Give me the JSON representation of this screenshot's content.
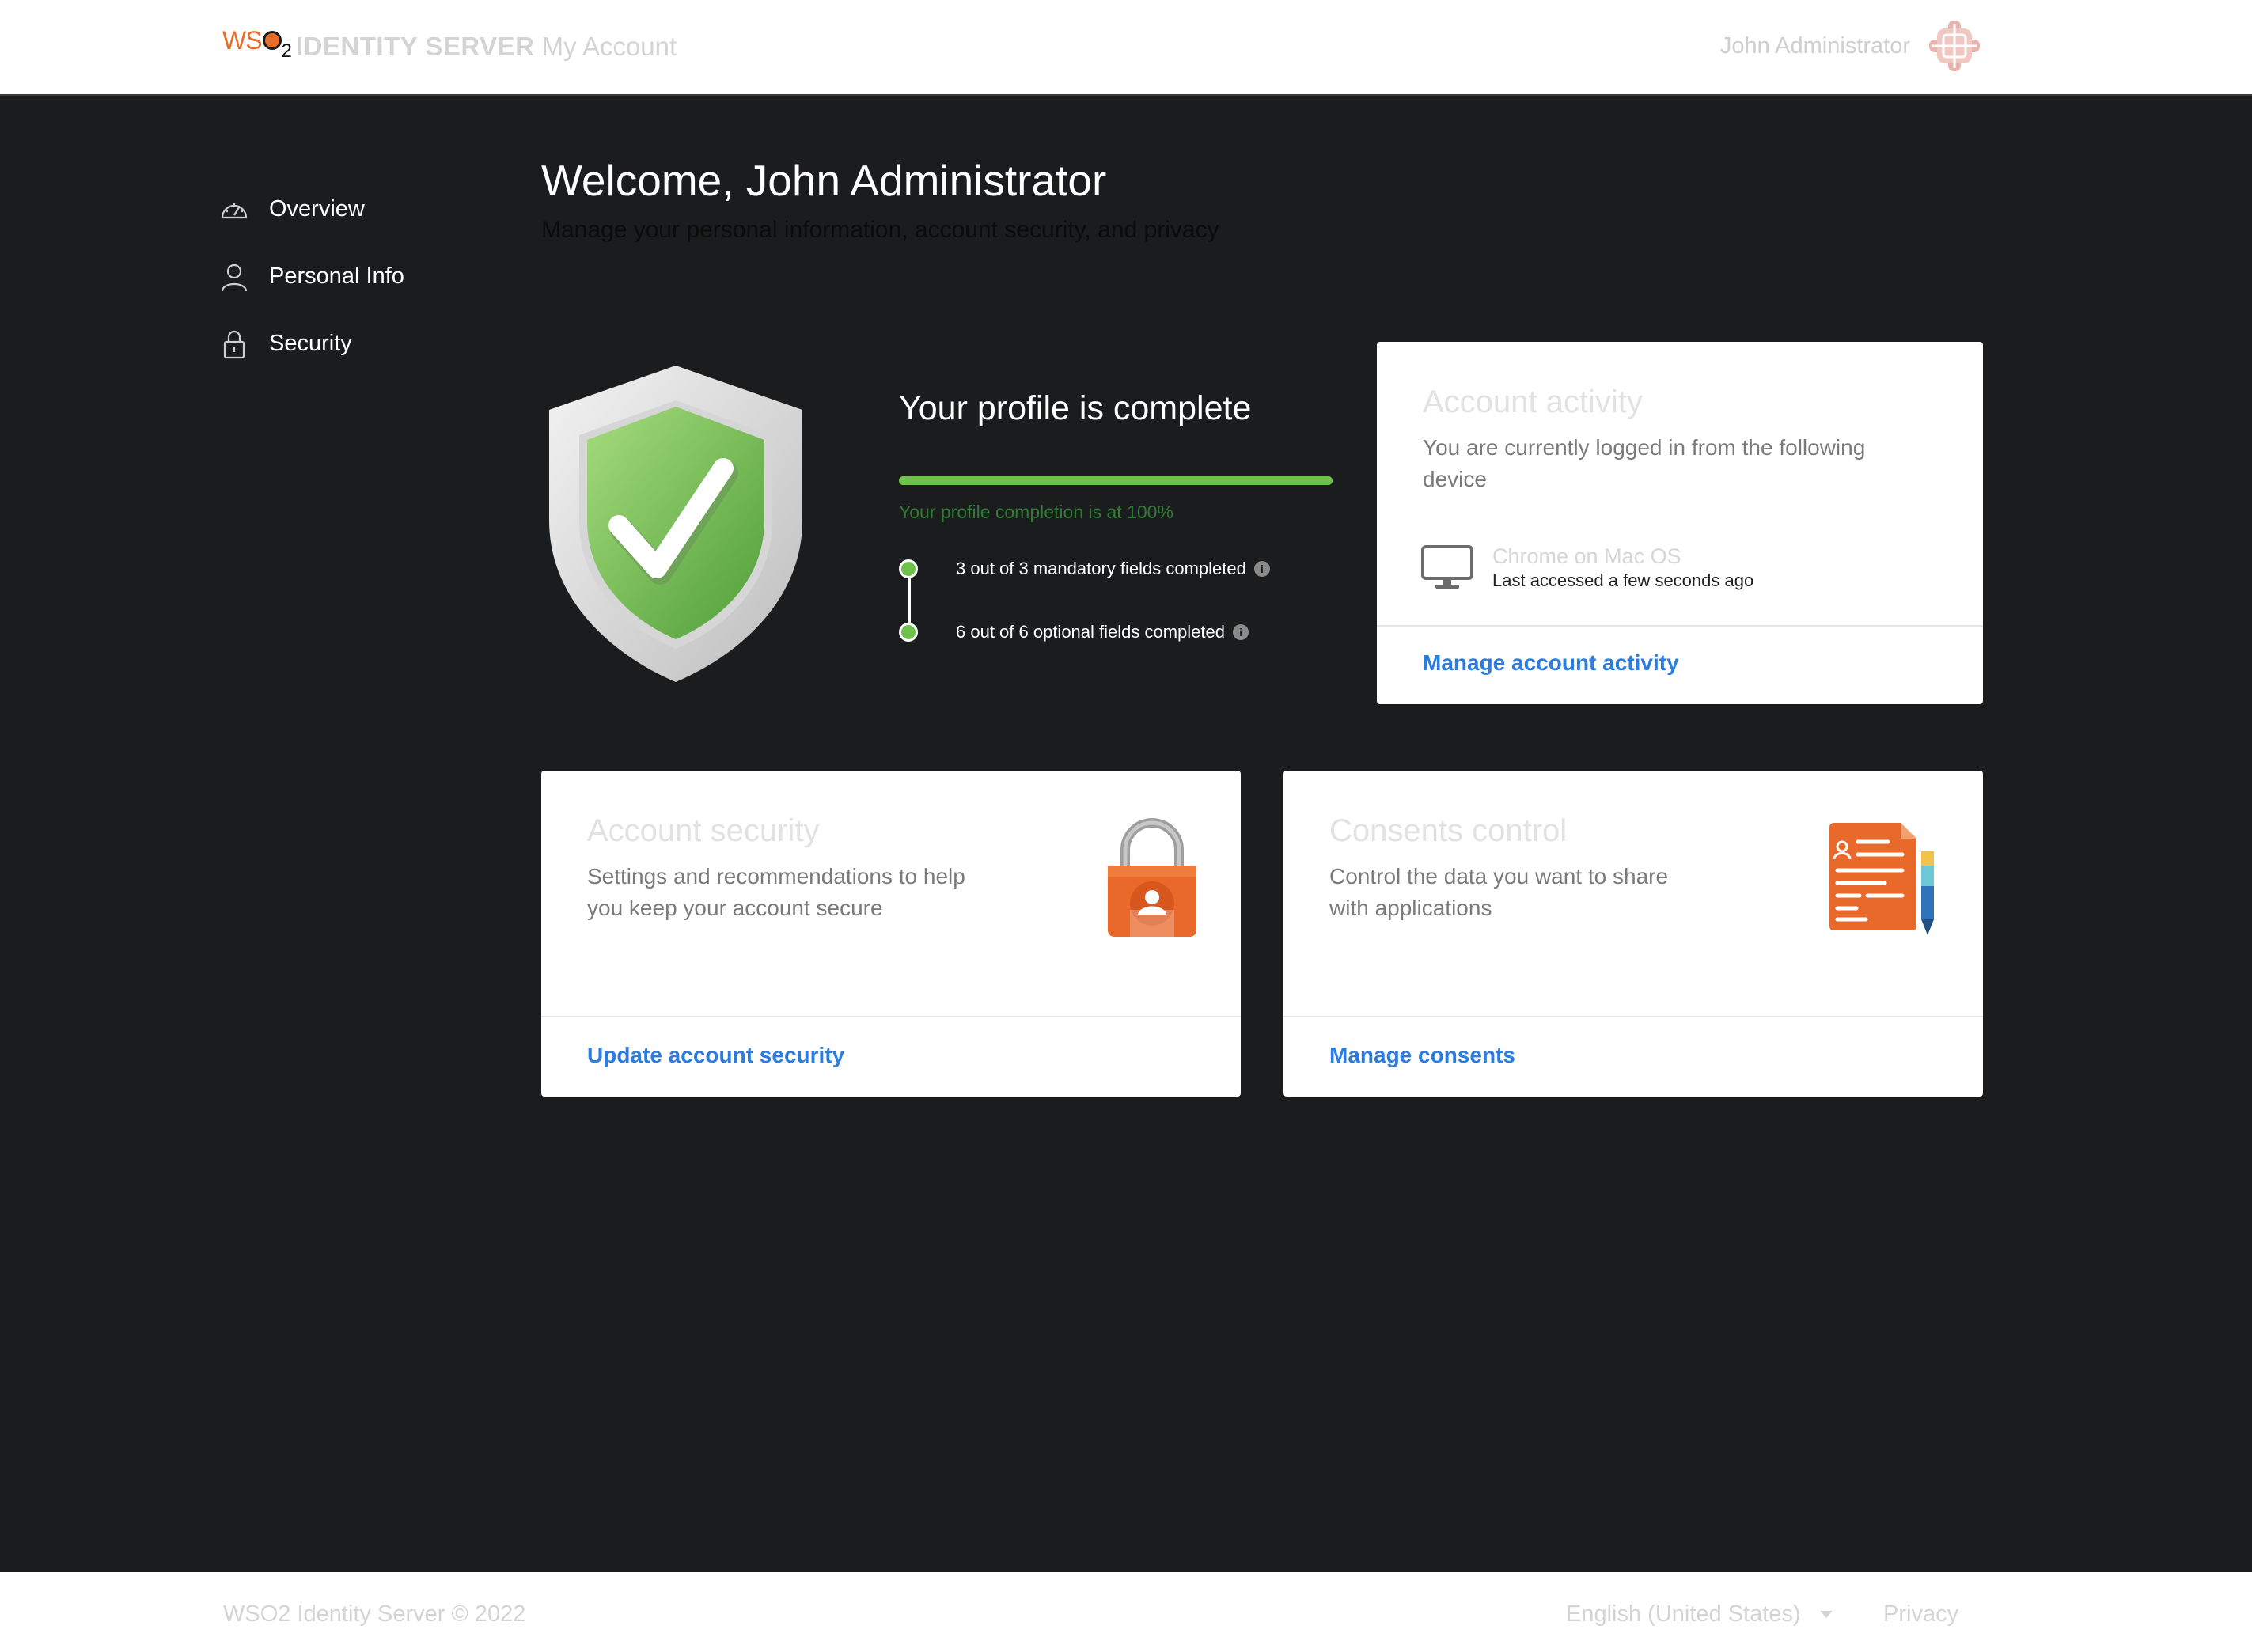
{
  "header": {
    "brand_logo": "WSO2",
    "product": "IDENTITY SERVER",
    "app": "My Account",
    "user_name": "John Administrator"
  },
  "sidebar": {
    "items": [
      {
        "label": "Overview",
        "icon": "speedometer-icon"
      },
      {
        "label": "Personal Info",
        "icon": "user-icon"
      },
      {
        "label": "Security",
        "icon": "lock-icon"
      }
    ]
  },
  "main": {
    "welcome": "Welcome, John Administrator",
    "subtitle": "Manage your personal information, account security, and privacy"
  },
  "profile": {
    "title": "Your profile is complete",
    "completion_caption": "Your profile completion is at 100%",
    "completion_percent": 100,
    "mandatory": "3 out of 3 mandatory fields completed",
    "optional": "6 out of 6 optional fields completed",
    "accent": "#6cc24a"
  },
  "cards": {
    "activity": {
      "title": "Account activity",
      "desc": "You are currently logged in from the following device",
      "device_name": "Chrome on Mac OS",
      "device_sub": "Last accessed a few seconds ago",
      "link": "Manage account activity"
    },
    "security": {
      "title": "Account security",
      "desc": "Settings and recommendations to help you keep your account secure",
      "link": "Update account security"
    },
    "consents": {
      "title": "Consents control",
      "desc": "Control the data you want to share with applications",
      "link": "Manage consents"
    },
    "link_color": "#2b7de0"
  },
  "footer": {
    "copyright": "WSO2 Identity Server © 2022",
    "language": "English (United States)",
    "privacy": "Privacy"
  }
}
